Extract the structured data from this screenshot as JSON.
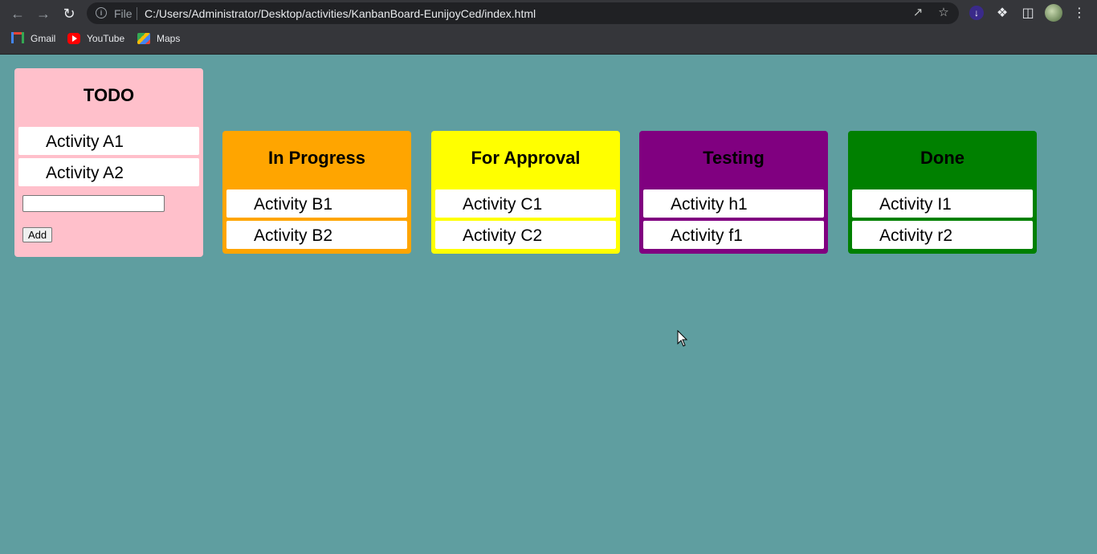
{
  "browser": {
    "file_label": "File",
    "url": "C:/Users/Administrator/Desktop/activities/KanbanBoard-EunijoyCed/index.html",
    "bookmarks": [
      {
        "label": "Gmail",
        "icon": "gmail-icon"
      },
      {
        "label": "YouTube",
        "icon": "youtube-icon"
      },
      {
        "label": "Maps",
        "icon": "maps-icon"
      }
    ]
  },
  "board": {
    "columns": [
      {
        "title": "TODO",
        "color": "#ffc0cb",
        "cards": [
          "Activity A1",
          "Activity A2"
        ],
        "add_label": "Add"
      },
      {
        "title": "In Progress",
        "color": "#ffa500",
        "cards": [
          "Activity B1",
          "Activity B2"
        ]
      },
      {
        "title": "For Approval",
        "color": "#ffff00",
        "cards": [
          "Activity C1",
          "Activity C2"
        ]
      },
      {
        "title": "Testing",
        "color": "#800080",
        "cards": [
          "Activity h1",
          "Activity f1"
        ]
      },
      {
        "title": "Done",
        "color": "#008000",
        "cards": [
          "Activity I1",
          "Activity r2"
        ]
      }
    ]
  },
  "colors": {
    "background": "#5f9ea0"
  }
}
